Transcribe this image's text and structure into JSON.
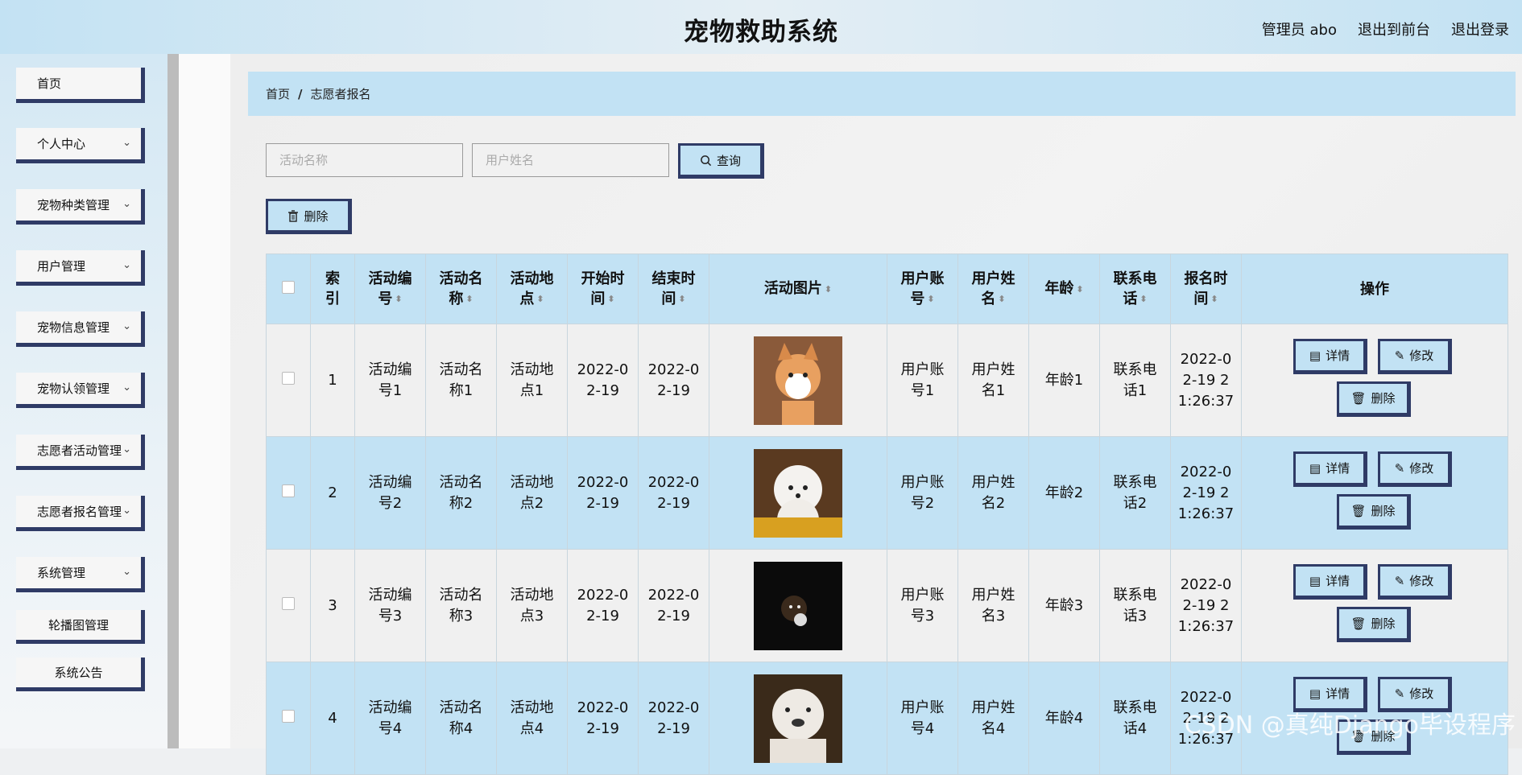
{
  "header": {
    "title": "宠物救助系统",
    "links": [
      "管理员 abo",
      "退出到前台",
      "退出登录"
    ]
  },
  "sidebar": {
    "items": [
      {
        "label": "首页",
        "chevron": false
      },
      {
        "label": "个人中心",
        "chevron": true
      },
      {
        "label": "宠物种类管理",
        "chevron": true
      },
      {
        "label": "用户管理",
        "chevron": true
      },
      {
        "label": "宠物信息管理",
        "chevron": true
      },
      {
        "label": "宠物认领管理",
        "chevron": true
      },
      {
        "label": "志愿者活动管理",
        "chevron": true
      },
      {
        "label": "志愿者报名管理",
        "chevron": true
      },
      {
        "label": "系统管理",
        "chevron": true
      },
      {
        "label": "轮播图管理",
        "chevron": false
      },
      {
        "label": "系统公告",
        "chevron": false
      }
    ]
  },
  "breadcrumb": {
    "home": "首页",
    "separator": "/",
    "current": "志愿者报名"
  },
  "search": {
    "activity_placeholder": "活动名称",
    "user_placeholder": "用户姓名",
    "query_label": "查询",
    "delete_label": "删除"
  },
  "table": {
    "headers": [
      "索引",
      "活动编号",
      "活动名称",
      "活动地点",
      "开始时间",
      "结束时间",
      "活动图片",
      "用户账号",
      "用户姓名",
      "年龄",
      "联系电话",
      "报名时间",
      "操作"
    ],
    "header_lines": [
      [
        "索",
        "引"
      ],
      [
        "活动编",
        "号"
      ],
      [
        "活动名",
        "称"
      ],
      [
        "活动地",
        "点"
      ],
      [
        "开始时",
        "间"
      ],
      [
        "结束时",
        "间"
      ],
      [
        "活动图片"
      ],
      [
        "用户账",
        "号"
      ],
      [
        "用户姓",
        "名"
      ],
      [
        "年龄"
      ],
      [
        "联系电",
        "话"
      ],
      [
        "报名时",
        "间"
      ],
      [
        "操作"
      ]
    ],
    "rows": [
      {
        "index": "1",
        "code": [
          "活动编",
          "号1"
        ],
        "name": [
          "活动名",
          "称1"
        ],
        "place": [
          "活动地",
          "点1"
        ],
        "start": [
          "2022-0",
          "2-19"
        ],
        "end": [
          "2022-0",
          "2-19"
        ],
        "account": [
          "用户账",
          "号1"
        ],
        "username": [
          "用户姓",
          "名1"
        ],
        "age": "年龄1",
        "phone": [
          "联系电",
          "话1"
        ],
        "time": [
          "2022-0",
          "2-19 2",
          "1:26:37"
        ],
        "pic": "corgi"
      },
      {
        "index": "2",
        "code": [
          "活动编",
          "号2"
        ],
        "name": [
          "活动名",
          "称2"
        ],
        "place": [
          "活动地",
          "点2"
        ],
        "start": [
          "2022-0",
          "2-19"
        ],
        "end": [
          "2022-0",
          "2-19"
        ],
        "account": [
          "用户账",
          "号2"
        ],
        "username": [
          "用户姓",
          "名2"
        ],
        "age": "年龄2",
        "phone": [
          "联系电",
          "话2"
        ],
        "time": [
          "2022-0",
          "2-19 2",
          "1:26:37"
        ],
        "pic": "white-dog"
      },
      {
        "index": "3",
        "code": [
          "活动编",
          "号3"
        ],
        "name": [
          "活动名",
          "称3"
        ],
        "place": [
          "活动地",
          "点3"
        ],
        "start": [
          "2022-0",
          "2-19"
        ],
        "end": [
          "2022-0",
          "2-19"
        ],
        "account": [
          "用户账",
          "号3"
        ],
        "username": [
          "用户姓",
          "名3"
        ],
        "age": "年龄3",
        "phone": [
          "联系电",
          "话3"
        ],
        "time": [
          "2022-0",
          "2-19 2",
          "1:26:37"
        ],
        "pic": "dark-cat"
      },
      {
        "index": "4",
        "code": [
          "活动编",
          "号4"
        ],
        "name": [
          "活动名",
          "称4"
        ],
        "place": [
          "活动地",
          "点4"
        ],
        "start": [
          "2022-0",
          "2-19"
        ],
        "end": [
          "2022-0",
          "2-19"
        ],
        "account": [
          "用户账",
          "号4"
        ],
        "username": [
          "用户姓",
          "名4"
        ],
        "age": "年龄4",
        "phone": [
          "联系电",
          "话4"
        ],
        "time": [
          "2022-0",
          "2-19 2",
          "1:26:37"
        ],
        "pic": "bulldog"
      }
    ],
    "op_labels": {
      "detail": "详情",
      "edit": "修改",
      "delete": "删除"
    }
  },
  "watermark": "CSDN @真纯Django毕设程序",
  "colors": {
    "accent": "#c2e2f4",
    "border": "#2f3b66"
  },
  "icons": {
    "chevron": "chevron-down-icon",
    "search": "search-icon",
    "trash": "trash-icon",
    "detail": "document-icon",
    "edit": "pencil-icon",
    "sort": "sort-icon"
  }
}
